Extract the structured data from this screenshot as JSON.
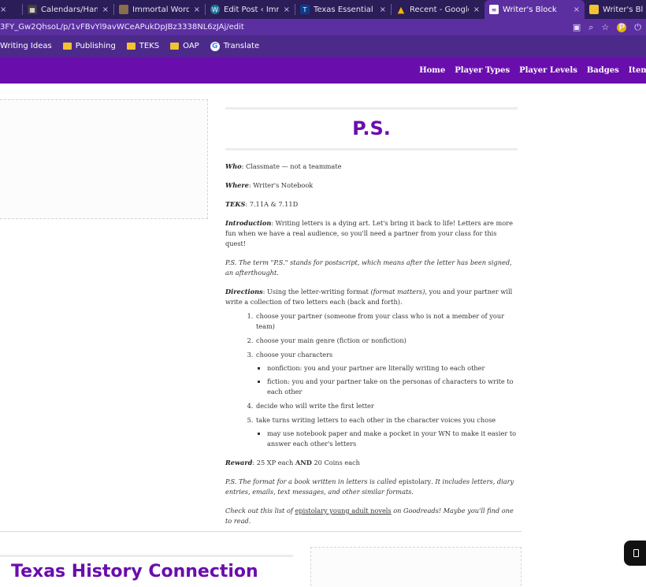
{
  "browser": {
    "tabs": [
      {
        "title": "",
        "favicon_color": "#2b1d57",
        "active": false
      },
      {
        "title": "Calendars/Handboo",
        "favicon_color": "#3f3f3f",
        "active": false
      },
      {
        "title": "Immortal Words of",
        "favicon_color": "#8a6d4a",
        "active": false
      },
      {
        "title": "Edit Post ‹ Immortal",
        "favicon_color": "#21759b",
        "active": false
      },
      {
        "title": "Texas Essential Know",
        "favicon_color": "#0b3c8c",
        "active": false
      },
      {
        "title": "Recent - Google Dri",
        "favicon_color": "#f4b400",
        "active": false
      },
      {
        "title": "Writer's Block",
        "favicon_color": "#ffffff",
        "active": true
      },
      {
        "title": "Writer's Block",
        "favicon_color": "#f2c230",
        "active": false
      }
    ],
    "close_glyph": "×",
    "url": "3FY_Gw2QhsoL/p/1vFBvYl9avWCeAPukDpJBz3338NL6zJAj/edit",
    "bookmarks": [
      "Writing Ideas",
      "Publishing",
      "TEKS",
      "OAP",
      "Translate"
    ]
  },
  "site": {
    "nav": [
      "Home",
      "Player Types",
      "Player Levels",
      "Badges",
      "Item"
    ]
  },
  "page": {
    "title": "P.S.",
    "who_label": "Who",
    "who": ": Classmate — not a teammate",
    "where_label": "Where",
    "where": ": Writer's Notebook",
    "teks_label": "TEKS",
    "teks": ": 7.11A & 7.11D",
    "intro_label": "Introduction",
    "intro": ": Writing letters is a dying art. Let's bring it back to life! Letters are more fun when we have a real audience, so you'll need a partner from your class for this quest!",
    "ps_note": "P.S. The term \"P.S.\" stands for postscript, which means after the letter has been signed, an afterthought.",
    "directions_label": "Directions",
    "directions_a": ": Using the letter-writing format ",
    "directions_em": "(format matters)",
    "directions_b": ", you and your partner will write a collection of two letters each (back and forth).",
    "steps": [
      "choose your partner (someone from your class who is not a member of your team)",
      "choose your main genre (fiction or nonfiction)",
      "choose your characters",
      "decide who will write the first letter",
      "take turns writing letters to each other in the character voices you chose"
    ],
    "step3_sub": [
      "nonfiction: you and your partner are literally writing to each other",
      "fiction: you and your partner take on the personas of characters to write to each other"
    ],
    "step5_sub": [
      "may use notebook paper and make a pocket in your WN to make it easier to answer each other's letters"
    ],
    "reward_label": "Reward",
    "reward_a": ": 25 XP each ",
    "reward_and": "AND",
    "reward_b": " 20 Coins each",
    "format_a": "P.S. The format for a book written in letters is called ",
    "format_word": "epistolary",
    "format_b": ". It includes letters, diary entries, emails, text messages, and other similar formats.",
    "check_a": "Check out this list of ",
    "check_link": "epistolary young adult novels",
    "check_b": " on Goodreads! Maybe you'll find one to read.",
    "section2_title": "Texas History Connection"
  }
}
